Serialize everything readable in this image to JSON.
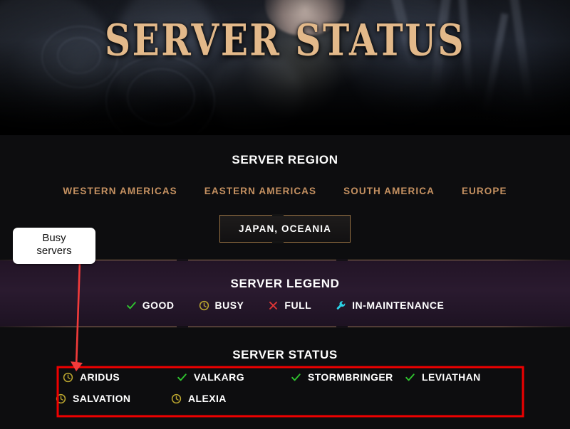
{
  "hero": {
    "title": "SERVER STATUS"
  },
  "region_section": {
    "heading": "SERVER REGION",
    "tabs": [
      {
        "label": "WESTERN AMERICAS",
        "selected": false
      },
      {
        "label": "EASTERN AMERICAS",
        "selected": false
      },
      {
        "label": "SOUTH AMERICA",
        "selected": false
      },
      {
        "label": "EUROPE",
        "selected": false
      }
    ],
    "selected_tab": {
      "label": "JAPAN, OCEANIA",
      "selected": true
    }
  },
  "legend_section": {
    "heading": "SERVER LEGEND",
    "items": [
      {
        "label": "GOOD",
        "icon": "check-icon",
        "color": "#2fc52f"
      },
      {
        "label": "BUSY",
        "icon": "clock-icon",
        "color": "#bca72f"
      },
      {
        "label": "FULL",
        "icon": "cross-icon",
        "color": "#e03636"
      },
      {
        "label": "IN-MAINTENANCE",
        "icon": "wrench-icon",
        "color": "#2ad2e6"
      }
    ]
  },
  "status_section": {
    "heading": "SERVER STATUS",
    "servers": [
      {
        "name": "ARIDUS",
        "status": "busy",
        "icon": "clock-icon",
        "color": "#bca72f"
      },
      {
        "name": "VALKARG",
        "status": "good",
        "icon": "check-icon",
        "color": "#2fc52f"
      },
      {
        "name": "STORMBRINGER",
        "status": "good",
        "icon": "check-icon",
        "color": "#2fc52f"
      },
      {
        "name": "LEVIATHAN",
        "status": "good",
        "icon": "check-icon",
        "color": "#2fc52f"
      },
      {
        "name": "SALVATION",
        "status": "busy",
        "icon": "clock-icon",
        "color": "#bca72f"
      },
      {
        "name": "ALEXIA",
        "status": "busy",
        "icon": "clock-icon",
        "color": "#bca72f"
      }
    ]
  },
  "annotations": {
    "callout_text": "Busy servers",
    "callout_line1": "Busy",
    "callout_line2": "servers",
    "arrow_color": "#f23b3b",
    "highlight_box_color": "#ee0000"
  },
  "colors": {
    "page_background": "#0d0d0f",
    "hero_title": "#e3b98a",
    "region_tab": "#c59161",
    "region_tab_selected_text": "#ffffff",
    "region_tab_border": "#9a7344",
    "legend_panel_background": "#2a1a2f",
    "divider": "#b08660",
    "heading_text": "#ffffff"
  }
}
